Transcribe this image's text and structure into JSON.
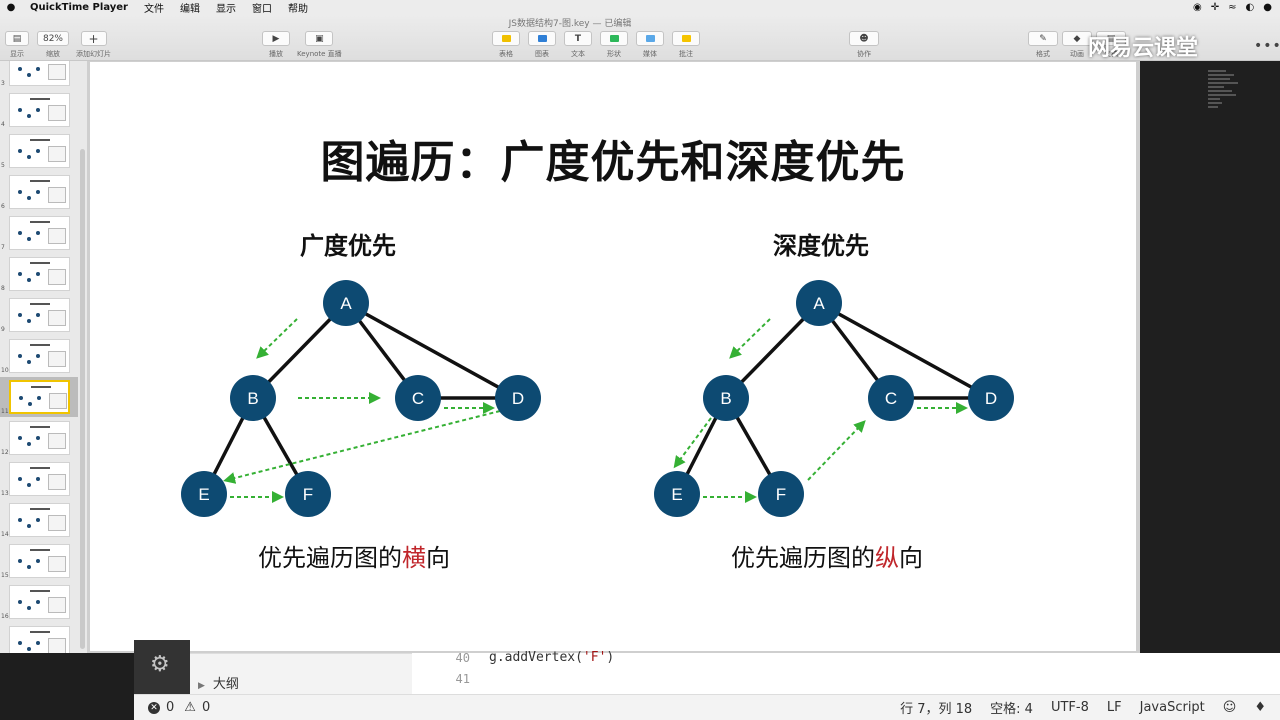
{
  "menubar": {
    "app": "QuickTime Player",
    "items": [
      "文件",
      "编辑",
      "显示",
      "窗口",
      "帮助"
    ]
  },
  "window": {
    "title": "JS数据结构7-图.key — 已编辑"
  },
  "toolbar": {
    "view_label": "显示",
    "zoom_value": "82%",
    "zoom_label": "缩放",
    "add_slide_label": "添加幻灯片",
    "play_label": "播放",
    "keynote_live_label": "Keynote 直播",
    "table_label": "表格",
    "chart_label": "图表",
    "text_label": "文本",
    "shape_label": "形状",
    "media_label": "媒体",
    "comment_label": "批注",
    "collaborate_label": "协作",
    "format_label": "格式",
    "animate_label": "动画",
    "document_label": "文稿"
  },
  "navigator": {
    "slide_numbers": [
      "3",
      "4",
      "5",
      "6",
      "7",
      "8",
      "9",
      "10",
      "11",
      "12",
      "13",
      "14",
      "15",
      "16",
      "17"
    ],
    "active_index": 8
  },
  "slide": {
    "title": "图遍历：广度优先和深度优先",
    "left": {
      "heading": "广度优先",
      "caption_prefix": "优先遍历图的",
      "caption_highlight": "横",
      "caption_suffix": "向",
      "nodes": [
        "A",
        "B",
        "C",
        "D",
        "E",
        "F"
      ]
    },
    "right": {
      "heading": "深度优先",
      "caption_prefix": "优先遍历图的",
      "caption_highlight": "纵",
      "caption_suffix": "向",
      "nodes": [
        "A",
        "B",
        "C",
        "D",
        "E",
        "F"
      ]
    },
    "colors": {
      "node": "#0d4a72",
      "arrow": "#35b034",
      "highlight": "#c0262b"
    }
  },
  "watermark": "网易云课堂",
  "vscode": {
    "outline_label": "大纲",
    "lines": [
      {
        "num": "40",
        "code_prefix": "g.addVertex(",
        "code_string": "'F'",
        "code_suffix": ")"
      },
      {
        "num": "41",
        "code_prefix": "",
        "code_string": "",
        "code_suffix": ""
      }
    ],
    "status": {
      "errors": "0",
      "warnings": "0",
      "position": "行 7，列 18",
      "spaces": "空格: 4",
      "encoding": "UTF-8",
      "eol": "LF",
      "language": "JavaScript"
    }
  }
}
